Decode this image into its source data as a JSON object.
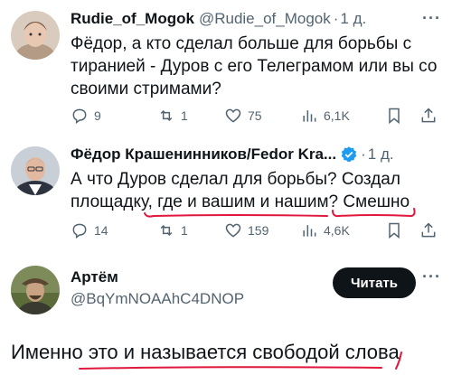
{
  "colors": {
    "text": "#0f1419",
    "secondary": "#536471",
    "verified": "#1d9bf0",
    "marker": "#e0173c",
    "button_bg": "#0f1419"
  },
  "tweet1": {
    "name": "Rudie_of_Mogok",
    "handle": "@Rudie_of_Mogok",
    "separator": "·",
    "time": "1 д.",
    "more": "···",
    "lines": [
      "Фёдор, а кто сделал больше для борьбы с",
      "тиранией - Дуров с его Телеграмом или вы со",
      "своими стримами?"
    ],
    "actions": {
      "replies": "9",
      "reposts": "1",
      "likes": "75",
      "views": "6,1K"
    }
  },
  "tweet2": {
    "name": "Фёдор Крашенинников/Fedor Kra...",
    "separator": "·",
    "time": "1 д.",
    "line1": "А что Дуров сделал для борьбы? Создал",
    "line2_prefix": "площадку, ",
    "line2_highlight": "где и вашим и нашим",
    "line2_mid": "? ",
    "line2_end": "Смешно",
    "actions": {
      "replies": "14",
      "reposts": "1",
      "likes": "159",
      "views": "4,6K"
    }
  },
  "profile": {
    "name": "Артём",
    "handle": "@BqYmNOAAhC4DNOP",
    "follow_label": "Читать",
    "more": "···"
  },
  "caption": {
    "prefix": "Именно ",
    "highlight": "это и называется свободой слова"
  },
  "icons": [
    "reply-icon",
    "repost-icon",
    "like-icon",
    "views-icon",
    "bookmark-icon",
    "share-icon",
    "verified-icon"
  ]
}
